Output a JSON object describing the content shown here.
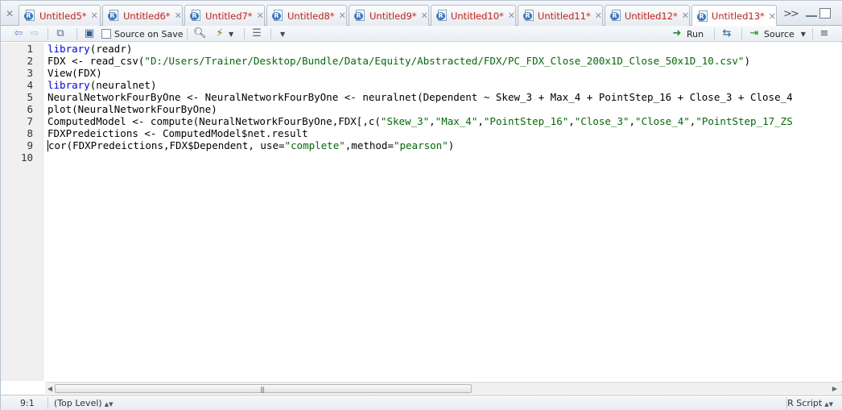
{
  "tabs": [
    {
      "label": "Untitled5*"
    },
    {
      "label": "Untitled6*"
    },
    {
      "label": "Untitled7*"
    },
    {
      "label": "Untitled8*"
    },
    {
      "label": "Untitled9*"
    },
    {
      "label": "Untitled10*"
    },
    {
      "label": "Untitled11*"
    },
    {
      "label": "Untitled12*"
    },
    {
      "label": "Untitled13*"
    }
  ],
  "active_tab": "Untitled13*",
  "toolbar": {
    "source_on_save": "Source on Save",
    "run": "Run",
    "source": "Source"
  },
  "editor": {
    "line_numbers": [
      "1",
      "2",
      "3",
      "4",
      "5",
      "6",
      "7",
      "8",
      "9",
      "10"
    ],
    "cursor_line": 9
  },
  "status": {
    "position": "9:1",
    "scope": "(Top Level)",
    "file_type": "R Script"
  },
  "colors": {
    "keyword": "#0000ff",
    "string": "#036a07",
    "modified_tab_text": "#c0231b"
  }
}
